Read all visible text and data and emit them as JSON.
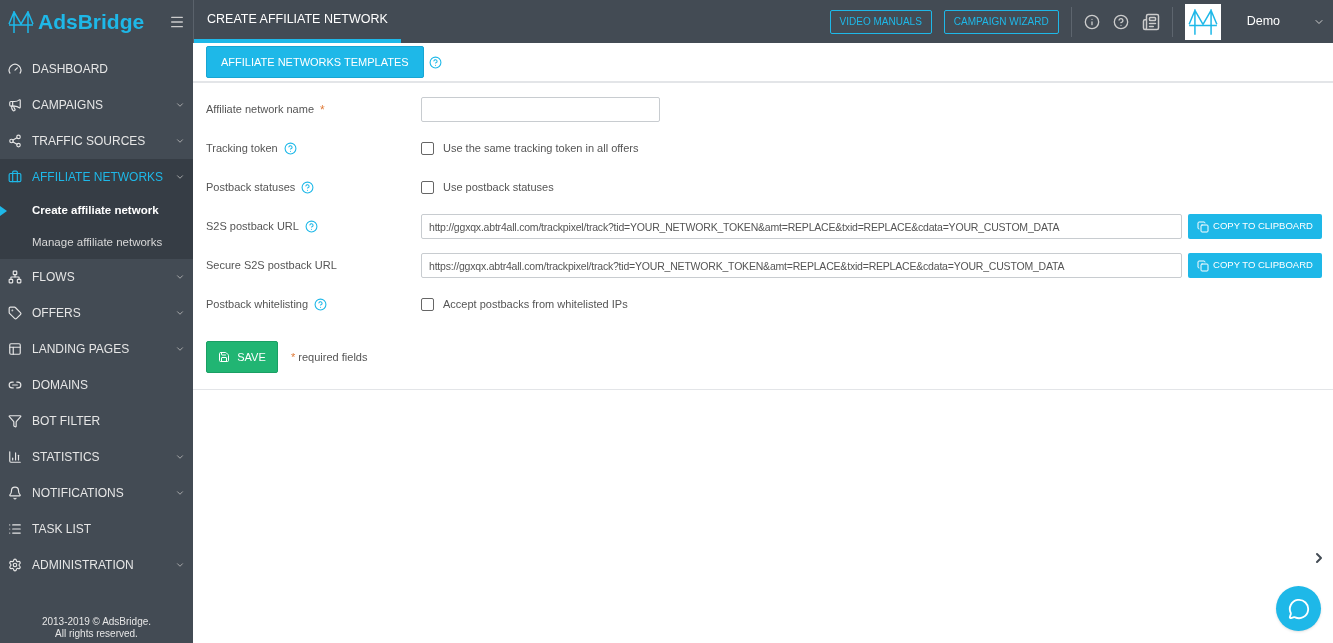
{
  "header": {
    "logo": "AdsBridge",
    "title": "CREATE AFFILIATE NETWORK",
    "buttons": [
      "VIDEO MANUALS",
      "CAMPAIGN WIZARD"
    ],
    "user": "Demo"
  },
  "sidebar": {
    "items": [
      {
        "label": "DASHBOARD",
        "expandable": false,
        "selected": false
      },
      {
        "label": "CAMPAIGNS",
        "expandable": true,
        "selected": false
      },
      {
        "label": "TRAFFIC SOURCES",
        "expandable": true,
        "selected": false
      },
      {
        "label": "AFFILIATE NETWORKS",
        "expandable": true,
        "selected": true,
        "children": [
          {
            "label": "Create affiliate network",
            "selected": true
          },
          {
            "label": "Manage affiliate networks",
            "selected": false
          }
        ]
      },
      {
        "label": "FLOWS",
        "expandable": true,
        "selected": false
      },
      {
        "label": "OFFERS",
        "expandable": true,
        "selected": false
      },
      {
        "label": "LANDING PAGES",
        "expandable": true,
        "selected": false
      },
      {
        "label": "DOMAINS",
        "expandable": false,
        "selected": false
      },
      {
        "label": "BOT FILTER",
        "expandable": false,
        "selected": false
      },
      {
        "label": "STATISTICS",
        "expandable": true,
        "selected": false
      },
      {
        "label": "NOTIFICATIONS",
        "expandable": true,
        "selected": false
      },
      {
        "label": "TASK LIST",
        "expandable": false,
        "selected": false
      },
      {
        "label": "ADMINISTRATION",
        "expandable": true,
        "selected": false
      }
    ],
    "footer": [
      "2013-2019 © AdsBridge.",
      "All rights reserved."
    ]
  },
  "toolbar": {
    "button": "AFFILIATE NETWORKS TEMPLATES"
  },
  "form": {
    "rows": [
      {
        "kind": "text",
        "label": "Affiliate network name",
        "required": true,
        "help": false,
        "value": ""
      },
      {
        "kind": "checkbox",
        "label": "Tracking token",
        "required": false,
        "help": true,
        "option": "Use the same tracking token in all offers",
        "checked": false
      },
      {
        "kind": "checkbox",
        "label": "Postback statuses",
        "required": false,
        "help": true,
        "option": "Use postback statuses",
        "checked": false
      },
      {
        "kind": "url",
        "label": "S2S postback URL",
        "required": false,
        "help": true,
        "value": "http://ggxqx.abtr4all.com/trackpixel/track?tid=YOUR_NETWORK_TOKEN&amt=REPLACE&txid=REPLACE&cdata=YOUR_CUSTOM_DATA",
        "button": "COPY TO CLIPBOARD"
      },
      {
        "kind": "url",
        "label": "Secure S2S postback URL",
        "required": false,
        "help": false,
        "value": "https://ggxqx.abtr4all.com/trackpixel/track?tid=YOUR_NETWORK_TOKEN&amt=REPLACE&txid=REPLACE&cdata=YOUR_CUSTOM_DATA",
        "button": "COPY TO CLIPBOARD"
      },
      {
        "kind": "checkbox",
        "label": "Postback whitelisting",
        "required": false,
        "help": true,
        "option": "Accept postbacks from whitelisted IPs",
        "checked": false
      }
    ],
    "save": "SAVE",
    "required_mark": "*",
    "required_note": "required fields"
  }
}
